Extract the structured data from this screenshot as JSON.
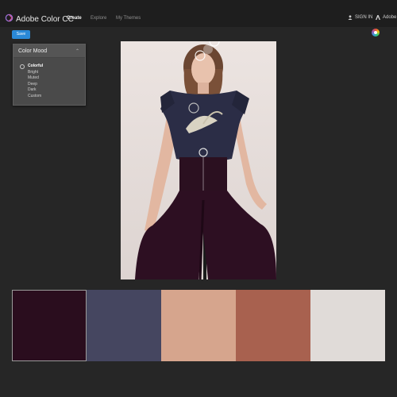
{
  "header": {
    "app_title": "Adobe Color CC",
    "nav": [
      "Create",
      "Explore",
      "My Themes"
    ],
    "active_nav": "Create",
    "signin_label": "SIGN IN",
    "adobe_label": "Adobe"
  },
  "toolbar": {
    "save_label": "Save"
  },
  "color_mood": {
    "title": "Color Mood",
    "items": [
      "Colorful",
      "Bright",
      "Muted",
      "Deep",
      "Dark",
      "Custom"
    ],
    "selected": "Colorful"
  },
  "swatches": [
    {
      "color": "#2a0d1e"
    },
    {
      "color": "#454660"
    },
    {
      "color": "#d6a58d"
    },
    {
      "color": "#a8614f"
    },
    {
      "color": "#e0dbd8"
    }
  ],
  "colors": {
    "accent": "#2a89d8",
    "background": "#262626",
    "topbar": "#1e1e1e"
  }
}
